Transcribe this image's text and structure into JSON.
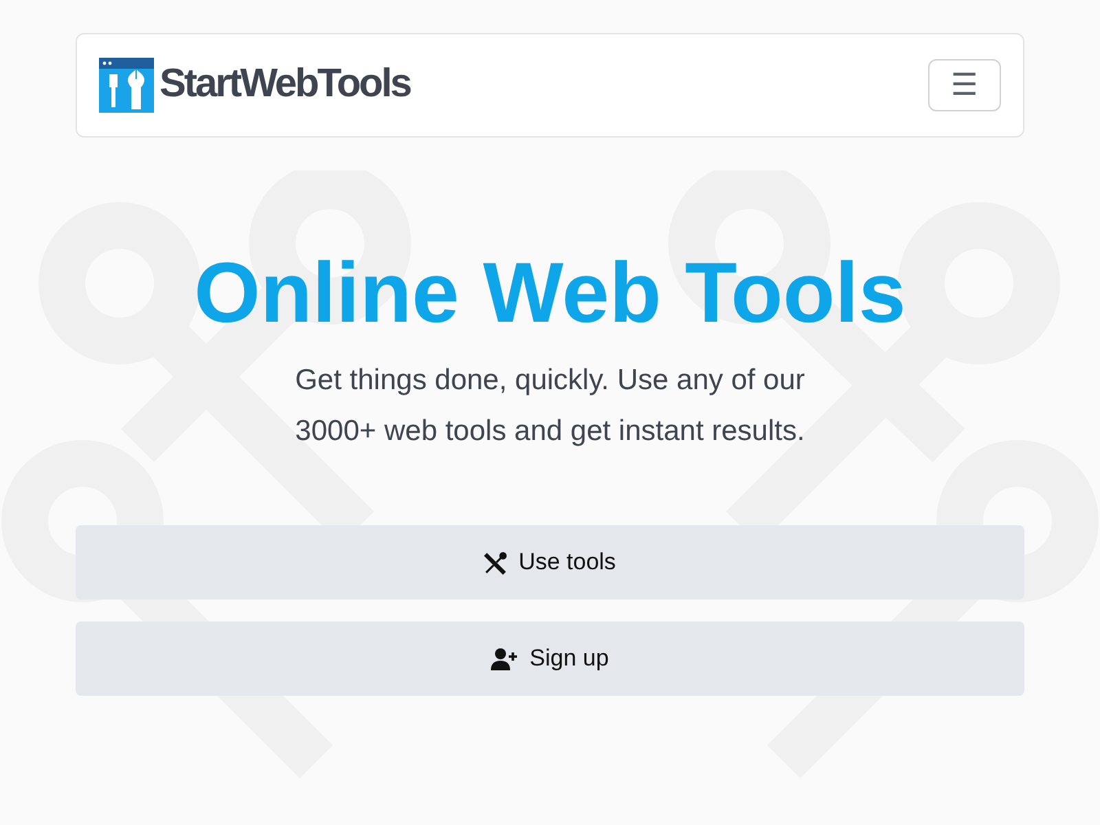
{
  "navbar": {
    "brand": "StartWebTools",
    "menu_toggle": "☰"
  },
  "hero": {
    "title": "Online Web Tools",
    "subtitle": "Get things done, quickly. Use any of our 3000+ web tools and get instant results."
  },
  "buttons": [
    {
      "kind": "tools",
      "label": "Use tools"
    },
    {
      "kind": "signup",
      "label": "Sign up"
    }
  ]
}
